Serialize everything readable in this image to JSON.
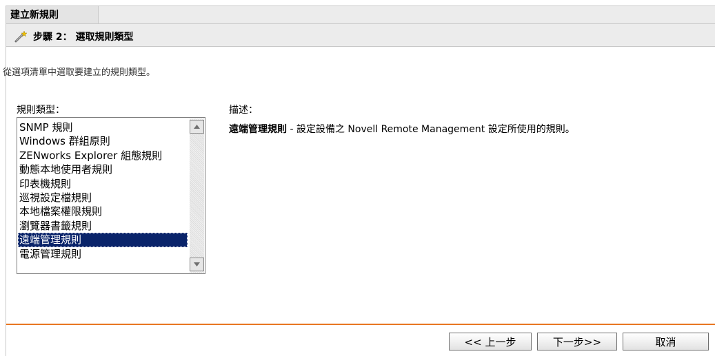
{
  "header": {
    "wizard_title": "建立新規則",
    "step_title": "步驟 2： 選取規則類型",
    "step_icon": "wand-icon"
  },
  "instruction": "從選項清單中選取要建立的規則類型。",
  "rule_types": {
    "label": "規則類型：",
    "items": [
      "SNMP 規則",
      "Windows 群組原則",
      "ZENworks Explorer 組態規則",
      "動態本地使用者規則",
      "印表機規則",
      "巡視設定檔規則",
      "本地檔案權限規則",
      "瀏覽器書籤規則",
      "遠端管理規則",
      "電源管理規則"
    ],
    "selected": "遠端管理規則"
  },
  "description": {
    "label": "描述：",
    "title": "遠端管理規則",
    "text": " - 設定設備之 Novell Remote Management 設定所使用的規則。"
  },
  "buttons": {
    "prev": "<< 上一步",
    "next": "下一步>>",
    "cancel": "取消"
  },
  "colors": {
    "accent_separator": "#e87722",
    "selection": "#0a246a",
    "header_bg": "#ececec"
  }
}
